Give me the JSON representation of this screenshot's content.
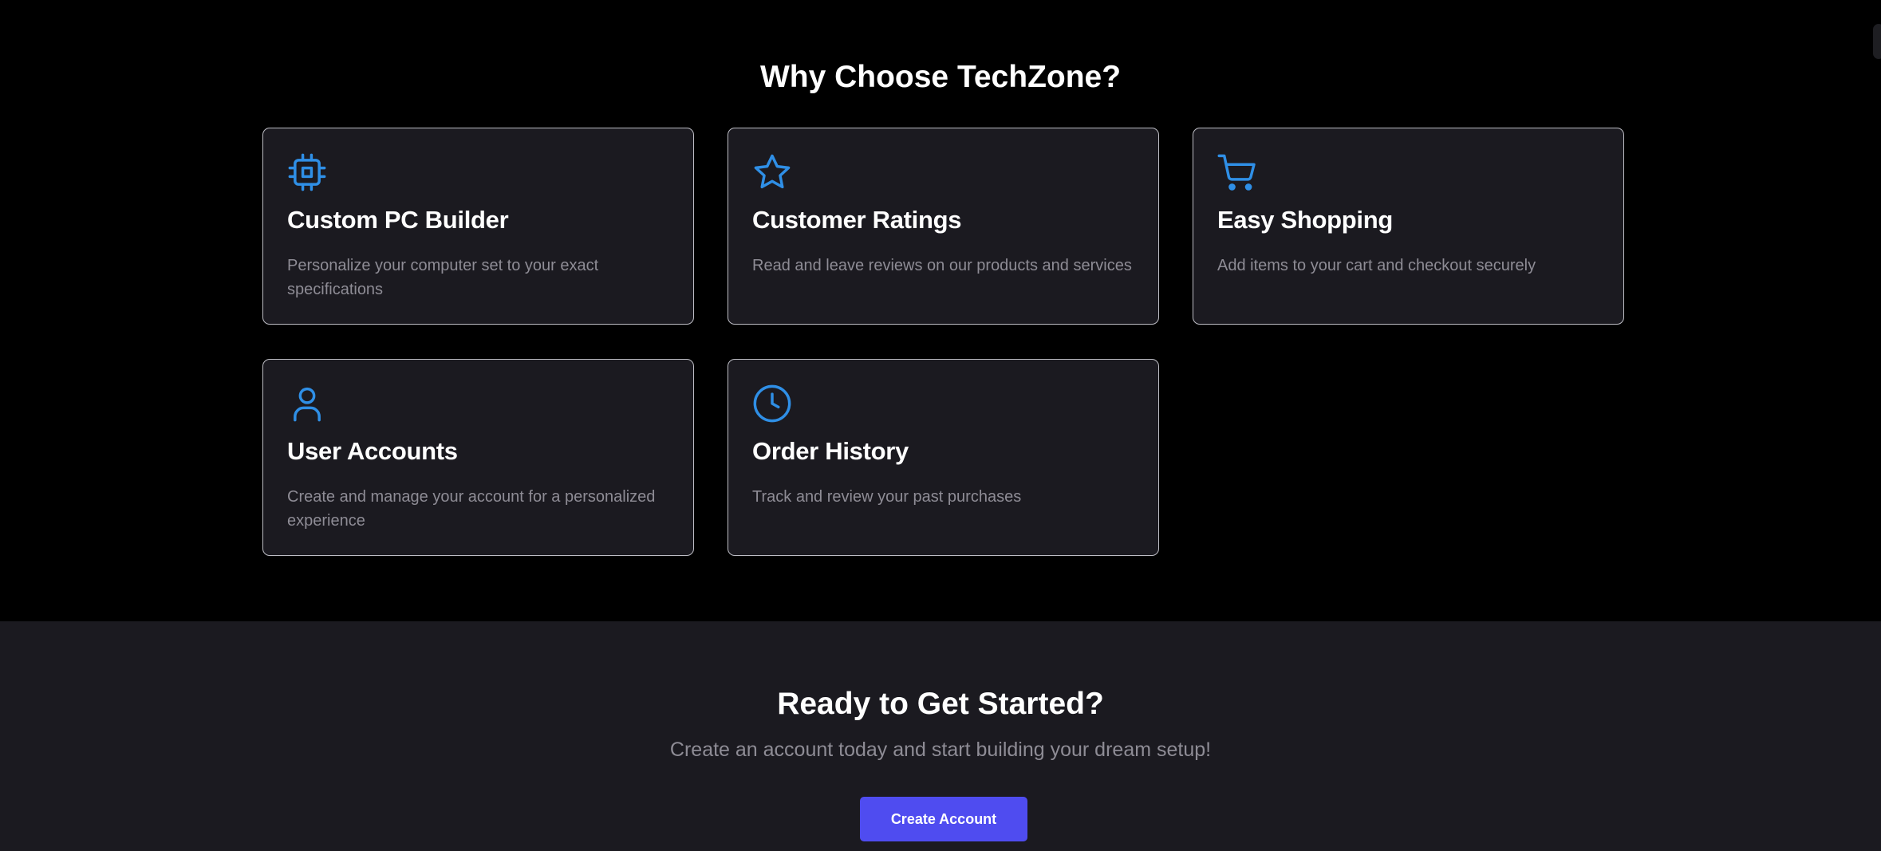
{
  "features": {
    "title": "Why Choose TechZone?",
    "cards": [
      {
        "icon": "cpu-icon",
        "title": "Custom PC Builder",
        "description": "Personalize your computer set to your exact specifications"
      },
      {
        "icon": "star-icon",
        "title": "Customer Ratings",
        "description": "Read and leave reviews on our products and services"
      },
      {
        "icon": "shopping-cart-icon",
        "title": "Easy Shopping",
        "description": "Add items to your cart and checkout securely"
      },
      {
        "icon": "user-icon",
        "title": "User Accounts",
        "description": "Create and manage your account for a personalized experience"
      },
      {
        "icon": "clock-icon",
        "title": "Order History",
        "description": "Track and review your past purchases"
      }
    ]
  },
  "cta": {
    "title": "Ready to Get Started?",
    "subtitle": "Create an account today and start building your dream setup!",
    "button_label": "Create Account"
  },
  "colors": {
    "page_background": "#000000",
    "card_background": "#1b1a20",
    "card_border": "#bdbdc4",
    "icon_accent": "#2f8fe6",
    "muted_text": "#8e8c95",
    "button_primary": "#4f4cf0"
  }
}
